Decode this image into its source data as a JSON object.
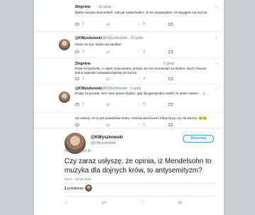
{
  "thread": [
    {
      "name": "Zbigniew",
      "time": "· 10 godz.",
      "text": "Byłem na paru koncertach i tak jak zasłuchałem, to nie zauważyłem, że dyrygent ma kurczę.",
      "reply_count": "1",
      "retweet_count": "",
      "like_count": "5"
    },
    {
      "name": "@KWyszkowski",
      "handle": "@KWyszkowski · 10 godz.",
      "text": "Może nie tym stanie się spotkać.",
      "reply_count": "1",
      "retweet_count": "",
      "like_count": "1"
    },
    {
      "name": "Zbigniew",
      "time": "· 9 godz.",
      "text": "Panie Krzysztofie, z całym szacunkiem, proszę się nie rozmieniać na drobne. Bach chociaż jedna legenda zostawiła legendę do końca.",
      "reply_count": "1",
      "retweet_count": "",
      "like_count": "3"
    },
    {
      "name": "@KWyszkowski",
      "handle": "@KWyszkowski · 9 godz.",
      "text": "Dzięki za poradę, sieć mam prawo brykać, gdy dyrygentyzdes madre mi przez nosem ... ;)",
      "reply_count": "1",
      "retweet_count": "",
      "like_count": "5"
    },
    {
      "text": "nie wierzę, że to jest prawdziwe konto, zresztą wieczorem zobaczymy czy nie wierzę. 😂😂",
      "reply_count": "",
      "retweet_count": "",
      "like_count": "1"
    }
  ],
  "main_tweet": {
    "name": "@KWyszkowski",
    "handle": "@KWyszkowski",
    "follow_label": "Obserwuj",
    "in_reply_label": "W odpowiedzi do",
    "text": "Czy zaraz usłyszę, że opinia, iż Mendelsohn to muzyka dla dojnych krów, to antysemityzm?",
    "meta": "00:07 - 22 lut 2018",
    "likes_count": "1",
    "likes_label": "polubienie"
  }
}
